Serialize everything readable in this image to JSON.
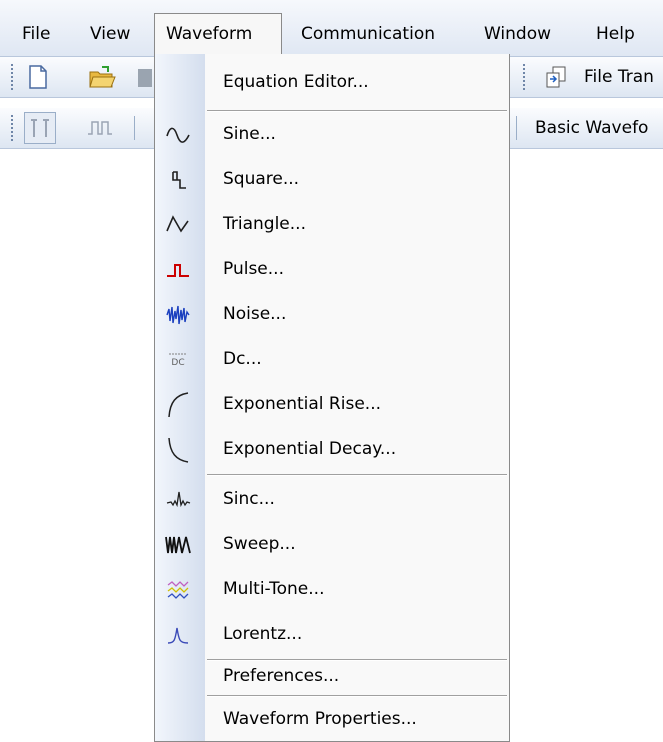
{
  "menubar": {
    "items": [
      {
        "label": "File"
      },
      {
        "label": "View"
      },
      {
        "label": "Waveform"
      },
      {
        "label": "Communication"
      },
      {
        "label": "Window"
      },
      {
        "label": "Help"
      }
    ],
    "active": "Waveform"
  },
  "toolbar1": {
    "icons": [
      "new-document-icon",
      "open-folder-icon",
      "save-icon",
      "file-transfer-icon"
    ],
    "file_transfer_label": "File Tran"
  },
  "toolbar2": {
    "icons": [
      "marker-tool-icon",
      "pulse-train-icon"
    ],
    "basic_waveform_label": "Basic Wavefo"
  },
  "waveform_menu": {
    "items": [
      {
        "label": "Equation Editor...",
        "icon": ""
      },
      {
        "label": "Sine...",
        "icon": "sine-icon"
      },
      {
        "label": "Square...",
        "icon": "square-wave-icon"
      },
      {
        "label": "Triangle...",
        "icon": "triangle-wave-icon"
      },
      {
        "label": "Pulse...",
        "icon": "pulse-icon"
      },
      {
        "label": "Noise...",
        "icon": "noise-icon"
      },
      {
        "label": "Dc...",
        "icon": "dc-icon"
      },
      {
        "label": "Exponential Rise...",
        "icon": "exponential-rise-icon"
      },
      {
        "label": "Exponential Decay...",
        "icon": "exponential-decay-icon"
      },
      {
        "label": "Sinc...",
        "icon": "sinc-icon"
      },
      {
        "label": "Sweep...",
        "icon": "sweep-icon"
      },
      {
        "label": "Multi-Tone...",
        "icon": "multi-tone-icon"
      },
      {
        "label": "Lorentz...",
        "icon": "lorentz-icon"
      },
      {
        "label": "Preferences...",
        "icon": ""
      },
      {
        "label": "Waveform Properties...",
        "icon": ""
      }
    ],
    "dc_icon_text": "DC"
  },
  "colors": {
    "pulse": "#cc0000",
    "noise": "#1a3fbf",
    "multitone_a": "#c060c0",
    "multitone_b": "#d0c000",
    "multitone_c": "#3050c0",
    "lorentz": "#3a4ab8"
  }
}
